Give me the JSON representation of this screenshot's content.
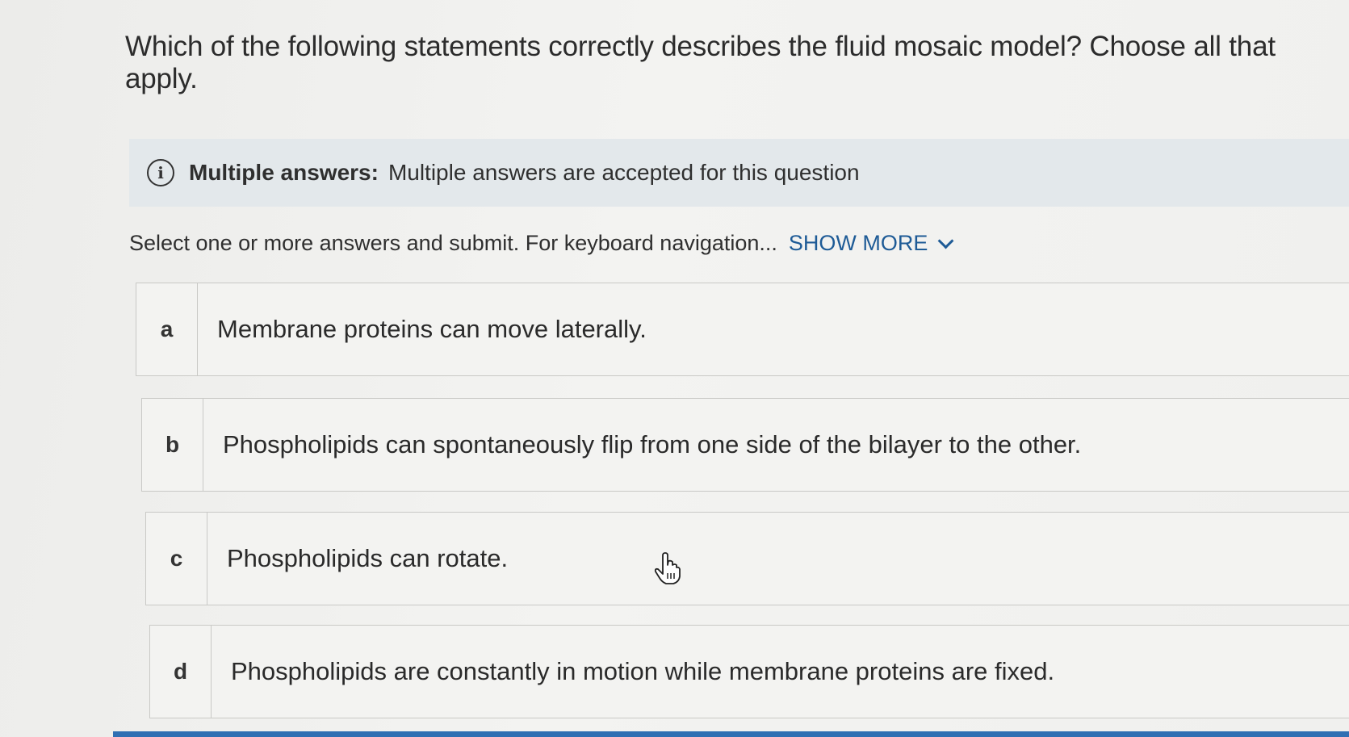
{
  "question": {
    "text": "Which of the following statements correctly describes the fluid mosaic model? Choose all that apply."
  },
  "info": {
    "icon": "info-icon",
    "title": "Multiple answers:",
    "text": "Multiple answers are accepted for this question"
  },
  "instructions": {
    "text": "Select one or more answers and submit. For keyboard navigation...",
    "show_more_label": "SHOW MORE"
  },
  "options": [
    {
      "letter": "a",
      "text": "Membrane proteins can move laterally."
    },
    {
      "letter": "b",
      "text": "Phospholipids can spontaneously flip from one side of the bilayer to the other."
    },
    {
      "letter": "c",
      "text": "Phospholipids can rotate."
    },
    {
      "letter": "d",
      "text": "Phospholipids are constantly in motion while membrane proteins are fixed."
    }
  ],
  "colors": {
    "accent": "#1e5b96",
    "banner": "#e3e8eb",
    "bottom_bar": "#2f6fb3"
  }
}
